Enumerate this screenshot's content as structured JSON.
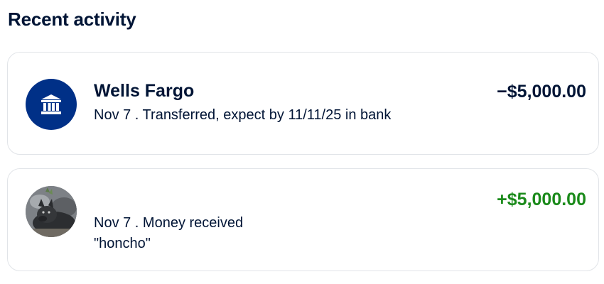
{
  "section": {
    "title": "Recent activity"
  },
  "activity": [
    {
      "avatar_icon": "bank-icon",
      "name": "Wells Fargo",
      "detail": "Nov 7 . Transferred, expect by 11/11/25 in bank",
      "amount": "−$5,000.00",
      "amount_color": "#001435"
    },
    {
      "avatar_icon": "user-photo",
      "detail": "Nov 7 . Money received",
      "note": "\"honcho\"",
      "amount": "+$5,000.00",
      "amount_color": "#1a8a1a"
    }
  ],
  "colors": {
    "text": "#001435",
    "bank_avatar_bg": "#003087",
    "credit": "#1a8a1a",
    "card_border": "#e1e4e8"
  }
}
